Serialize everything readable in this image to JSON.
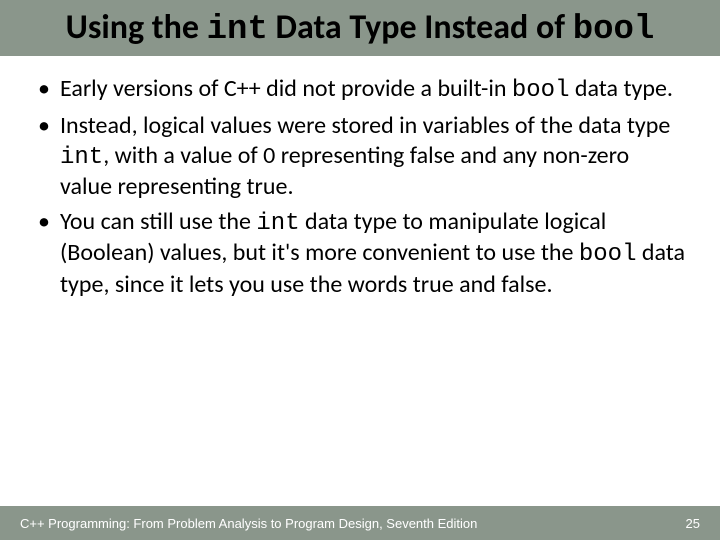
{
  "title": {
    "part1": "Using the ",
    "code1": "int",
    "part2": " Data Type Instead of ",
    "code2": "bool"
  },
  "bullets": [
    {
      "pre": "Early versions of C++ did not provide a built-in ",
      "code1": "bool",
      "post": " data type."
    },
    {
      "pre": "Instead, logical values were stored in variables of the data type ",
      "code1": "int",
      "post": ", with a value of 0 representing false and any non-zero value representing true."
    },
    {
      "pre": "You can still use the ",
      "code1": "int",
      "mid": " data type to manipulate logical (Boolean) values, but it's more convenient to use the ",
      "code2": "bool",
      "post": " data type, since it lets you use the words true and false."
    }
  ],
  "footer": {
    "book": "C++ Programming: From Problem Analysis to Program Design, Seventh Edition",
    "page": "25"
  }
}
